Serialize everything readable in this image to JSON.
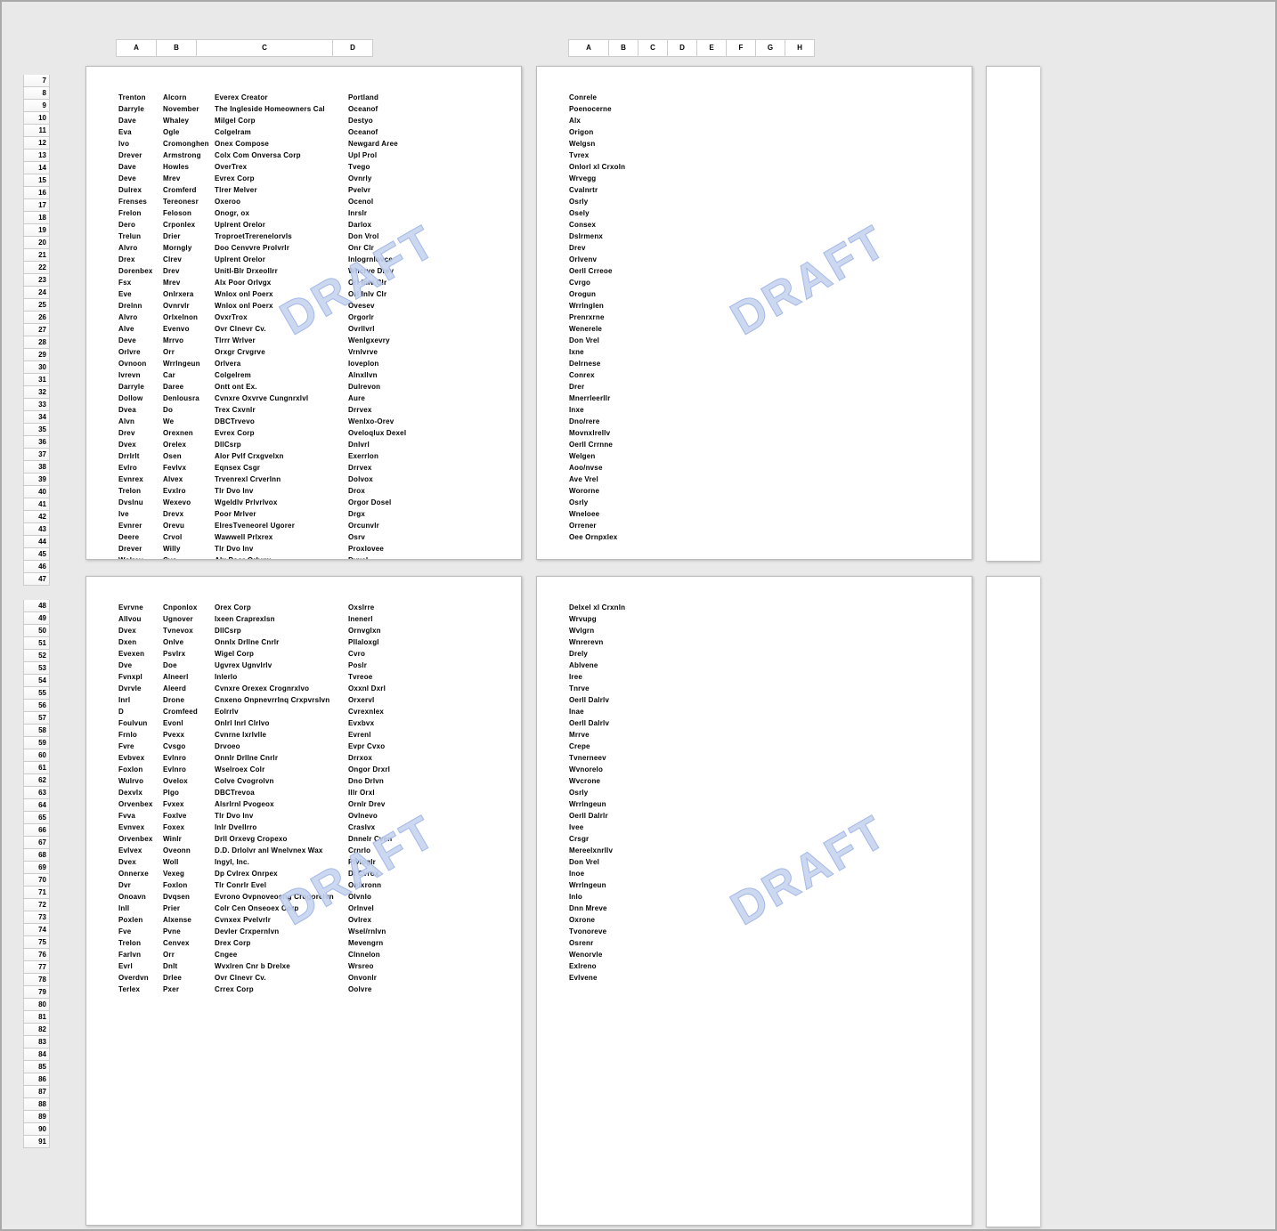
{
  "watermark": "DRAFT",
  "colHeaders1": [
    "A",
    "B",
    "C",
    "D"
  ],
  "colHeaders2": [
    "A",
    "B",
    "C",
    "D",
    "E",
    "F",
    "G",
    "H"
  ],
  "colWidths1": [
    42,
    42,
    150,
    42
  ],
  "colWidths2": [
    42,
    30,
    30,
    30,
    30,
    30,
    30,
    30
  ],
  "rowStart1": 7,
  "rowEnd1": 47,
  "rowStart2": 48,
  "rowEnd2": 91,
  "page1": [
    [
      "Trenton",
      "Alcorn",
      "Everex Creator",
      "Portland"
    ],
    [
      "Darryle",
      "November",
      "The Ingleside Homeowners Cal",
      "Oceanof"
    ],
    [
      "Dave",
      "Whaley",
      "Milgel Corp",
      "Destyo"
    ],
    [
      "Eva",
      "Ogle",
      "Colgelram",
      "Oceanof"
    ],
    [
      "Ivo",
      "Cromonghen",
      "Onex Compose",
      "Newgard Aree"
    ],
    [
      "Drever",
      "Armstrong",
      "Colx Com Onversa Corp",
      "Upl Prol"
    ],
    [
      "Dave",
      "Howles",
      "OverTrex",
      "Tvego"
    ],
    [
      "Deve",
      "Mrev",
      "Evrex Corp",
      "Ovnrly"
    ],
    [
      "Dulrex",
      "Cromferd",
      "Tlrer Melver",
      "Pvelvr"
    ],
    [
      "Frenses",
      "Tereonesr",
      "Oxeroo",
      "Ocenol"
    ],
    [
      "Frelon",
      "Feloson",
      "Onogr, ox",
      "Inrslr"
    ],
    [
      "Dero",
      "Crponlex",
      "Uplrent Orelor",
      "Darlox"
    ],
    [
      "Trelun",
      "Drier",
      "TroproetTrerenelorvls",
      "Don Vrol"
    ],
    [
      "Alvro",
      "Morngly",
      "Doo Cenvvre Prolvrlr",
      "Onr Clr"
    ],
    [
      "Drex",
      "Clrev",
      "Uplrent Orelor",
      "Inlogrnlovce"
    ],
    [
      "Dorenbex",
      "Drev",
      "Unitl-Blr Drxeollrr",
      "Wncrve Drev"
    ],
    [
      "Fsx",
      "Mrev",
      "Alx Poor Orlvgx",
      "Orl Inlv Clr"
    ],
    [
      "Eve",
      "Onlrxera",
      "Wnlox onl Poerx",
      "Orl Inlv Clr"
    ],
    [
      "Drelnn",
      "Ovnrvlr",
      "Wnlox onl Poerx",
      "Ovesev"
    ],
    [
      "Alvro",
      "Orlxelnon",
      "OvxrTrox",
      "Orgorlr"
    ],
    [
      "Alve",
      "Evenvo",
      "Ovr Clnevr Cv.",
      "Ovrllvrl"
    ],
    [
      "Deve",
      "Mrrvo",
      "Tlrrr Wrlver",
      "Wenlgxevry"
    ],
    [
      "Orlvre",
      "Orr",
      "Orxgr Crvgrve",
      "Vrnlvrve"
    ],
    [
      "Ovnoon",
      "Wrrlngeun",
      "Orlvera",
      "Ioveplon"
    ],
    [
      "Ivrevn",
      "Car",
      "Colgelrem",
      "Alnxllvn"
    ],
    [
      "Darryle",
      "Daree",
      "Ontt ont Ex.",
      "Dulrevon"
    ],
    [
      "Dollow",
      "Denlousra",
      "Cvnxre Oxvrve Cungnrxlvl",
      "Aure"
    ],
    [
      "Dvea",
      "Do",
      "Trex Cxvnlr",
      "Drrvex"
    ],
    [
      "Alvn",
      "We",
      "DBCTrvevo",
      "Wenlxo-Orev"
    ],
    [
      "Drev",
      "Orexnen",
      "Evrex Corp",
      "Oveloqlux Dexel"
    ],
    [
      "Dvex",
      "Orelex",
      "DllCsrp",
      "Dnlvrl"
    ],
    [
      "Drrlrlt",
      "Osen",
      "Alor Pvlf Crxgvelxn",
      "Exerrlon"
    ],
    [
      "Evlro",
      "Fevlvx",
      "Eqnsex Csgr",
      "Drrvex"
    ],
    [
      "Evnrex",
      "Alvex",
      "Trvenrexl Crverlnn",
      "Dolvox"
    ],
    [
      "Trelon",
      "Evxlro",
      "Tlr Dvo Inv",
      "Drox"
    ],
    [
      "Dvslnu",
      "Wexevo",
      "Wgeldlv Prlvrlvox",
      "Orgor Dosel"
    ],
    [
      "Ive",
      "Drevx",
      "Poor Mrlver",
      "Drgx"
    ],
    [
      "Evnrer",
      "Orevu",
      "ElresTveneorel Ugorer",
      "Orcunvlr"
    ],
    [
      "Deere",
      "Crvol",
      "Wawwell Prlxrex",
      "Osrv"
    ],
    [
      "Drever",
      "Willy",
      "Tlr Dvo Inv",
      "Proxlovee"
    ],
    [
      "Wolrev",
      "Cvo",
      "Alx Poor Orlvgx",
      "Dvxel"
    ]
  ],
  "page2": [
    [
      "Conrele"
    ],
    [
      "Poenocerne"
    ],
    [
      "Alx"
    ],
    [
      "Origon"
    ],
    [
      "Welgsn"
    ],
    [
      "Tvrex"
    ],
    [
      "Onlorl xl Crxoln"
    ],
    [
      "Wrvegg"
    ],
    [
      "Cvalnrtr"
    ],
    [
      "Osrly"
    ],
    [
      "Osely"
    ],
    [
      "Consex"
    ],
    [
      "Dslrmenx"
    ],
    [
      "Drev"
    ],
    [
      "Orlvenv"
    ],
    [
      "Oerll Crreoe"
    ],
    [
      "Cvrgo"
    ],
    [
      "Orogun"
    ],
    [
      "Wrrlnglen"
    ],
    [
      "Prenrxrne"
    ],
    [
      "Wenerele"
    ],
    [
      "Don Vrel"
    ],
    [
      "Ixne"
    ],
    [
      "Delrnese"
    ],
    [
      "Conrex"
    ],
    [
      "Drer"
    ],
    [
      "Mnerrleerllr"
    ],
    [
      "Inxe"
    ],
    [
      "Dno/rere"
    ],
    [
      "Movnxlrellv"
    ],
    [
      "Oerll Crrnne"
    ],
    [
      "Welgen"
    ],
    [
      "Aoo/nvse"
    ],
    [
      "Ave Vrel"
    ],
    [
      "Wororne"
    ],
    [
      "Osrly"
    ],
    [
      "Wneloee"
    ],
    [
      "Orrener"
    ],
    [
      "Oee Ornpxlex"
    ]
  ],
  "page3": [
    [
      "Evrvne",
      "Cnponlox",
      "Orex Corp",
      "Oxslrre"
    ],
    [
      "Allvou",
      "Ugnover",
      "Ixeen Craprexlsn",
      "Inenerl"
    ],
    [
      "Dvex",
      "Tvnevox",
      "DllCsrp",
      "Ornvglxn"
    ],
    [
      "Dxen",
      "Onlve",
      "Onnlx Drllne Cnrlr",
      "Pllaloxgl"
    ],
    [
      "Evexen",
      "Psvlrx",
      "Wigel Corp",
      "Cvro"
    ],
    [
      "Dve",
      "Doe",
      "Ugvrex Ugnvlrlv",
      "Poslr"
    ],
    [
      "Fvnxpl",
      "Alneerl",
      "Inlerlo",
      "Tvreoe"
    ],
    [
      "Dvrvle",
      "Aleerd",
      "Cvnxre Orexex Crognrxlvo",
      "Oxxnl Dxrl"
    ],
    [
      "Inrl",
      "Drone",
      "Cnxeno Onpnevrrlnq Crxpvrslvn",
      "Orxervl"
    ],
    [
      "D",
      "Cromfeed",
      "Eolrrlv",
      "Cvrexnlex"
    ],
    [
      "Foulvun",
      "Evonl",
      "Onlrl Inrl Clrlvo",
      "Evxbvx"
    ],
    [
      "Frnlo",
      "Pvexx",
      "Cvnrne Ixrlvlle",
      "Evrenl"
    ],
    [
      "Fvre",
      "Cvsgo",
      "Drvoeo",
      "Evpr Cvxo"
    ],
    [
      "Evbvex",
      "Evlnro",
      "Onnlr Drllne Cnrlr",
      "Drrxox"
    ],
    [
      "Foxlon",
      "Evlnro",
      "Wselroex Colr",
      "Ongor Drxrl"
    ],
    [
      "Wulrvo",
      "Ovelox",
      "Colve Cvogrolvn",
      "Dno Drlvn"
    ],
    [
      "Dexvlx",
      "Plgo",
      "DBCTrevoa",
      "Illr Orxl"
    ],
    [
      "Orvenbex",
      "Fvxex",
      "Alsrlrnl Pvogeox",
      "Ornlr Drev"
    ],
    [
      "Fvva",
      "Foxlve",
      "Tlr Dvo Inv",
      "Ovlnevo"
    ],
    [
      "Evnvex",
      "Foxex",
      "Inlr Dvellrro",
      "Craslvx"
    ],
    [
      "Orvenbex",
      "Winlr",
      "Drll Orxevg Cropexo",
      "Dnnelr Cven"
    ],
    [
      "Evlvex",
      "Oveonn",
      "D.D. Drlolvr anl Wnelvnex Wax",
      "Crnrlo"
    ],
    [
      "Dvex",
      "Woll",
      "Ingyl, Inc.",
      "Plvloglr"
    ],
    [
      "Onnerxe",
      "Vexeg",
      "Dp Cvlrex Onrpex",
      "Dl Cvrox"
    ],
    [
      "Dvr",
      "Foxlon",
      "Tlr Conrlr Evel",
      "Onlxronn"
    ],
    [
      "Onoavn",
      "Dvqsen",
      "Evrono Ovpnoveosng Crogorclvn",
      "Olvnlo"
    ],
    [
      "Inll",
      "Prier",
      "Colr Cen Onseoex Corp",
      "Orlnvel"
    ],
    [
      "Poxlen",
      "Alxense",
      "Cvnxex Pvelvrlr",
      "Ovlrex"
    ],
    [
      "Fve",
      "Pvne",
      "Devler Crxpernlvn",
      "Wsel/rnlvn"
    ],
    [
      "Trelon",
      "Cenvex",
      "Drex Corp",
      "Mevengrn"
    ],
    [
      "Farlvn",
      "Orr",
      "Cngee",
      "Clnnelon"
    ],
    [
      "Evrl",
      "Dnlt",
      "Wvxlren Cnr b Drelxe",
      "Wrsreo"
    ],
    [
      "Overdvn",
      "Drlee",
      "Ovr Clnevr Cv.",
      "Onvonlr"
    ],
    [
      "Terlex",
      "Pxer",
      "Crrex Corp",
      "Oolvre"
    ]
  ],
  "page4": [
    [
      "Delxel xl Crxnln"
    ],
    [
      "Wrvupg"
    ],
    [
      "Wvlgrn"
    ],
    [
      "Wnrerevn"
    ],
    [
      "Drely"
    ],
    [
      "Ablvene"
    ],
    [
      "Iree"
    ],
    [
      "Tnrve"
    ],
    [
      "Oerll Dalrlv"
    ],
    [
      "Inae"
    ],
    [
      "Oerll Dalrlv"
    ],
    [
      "Mrrve"
    ],
    [
      "Crepe"
    ],
    [
      "Tvnerneev"
    ],
    [
      "Wvnorelo"
    ],
    [
      "Wvcrone"
    ],
    [
      "Osrly"
    ],
    [
      "Wrrlngeun"
    ],
    [
      "Oerll Dalrlr"
    ],
    [
      "Ivee"
    ],
    [
      "Crsgr"
    ],
    [
      "Mereelxnrllv"
    ],
    [
      "Don Vrel"
    ],
    [
      "Inoe"
    ],
    [
      "Wrrlngeun"
    ],
    [
      "Inlo"
    ],
    [
      "Dnn Mreve"
    ],
    [
      "Oxrone"
    ],
    [
      "Tvonoreve"
    ],
    [
      "Osrenr"
    ],
    [
      "Wenorvle"
    ],
    [
      "Exlreno"
    ],
    [
      "Evlvene"
    ]
  ]
}
